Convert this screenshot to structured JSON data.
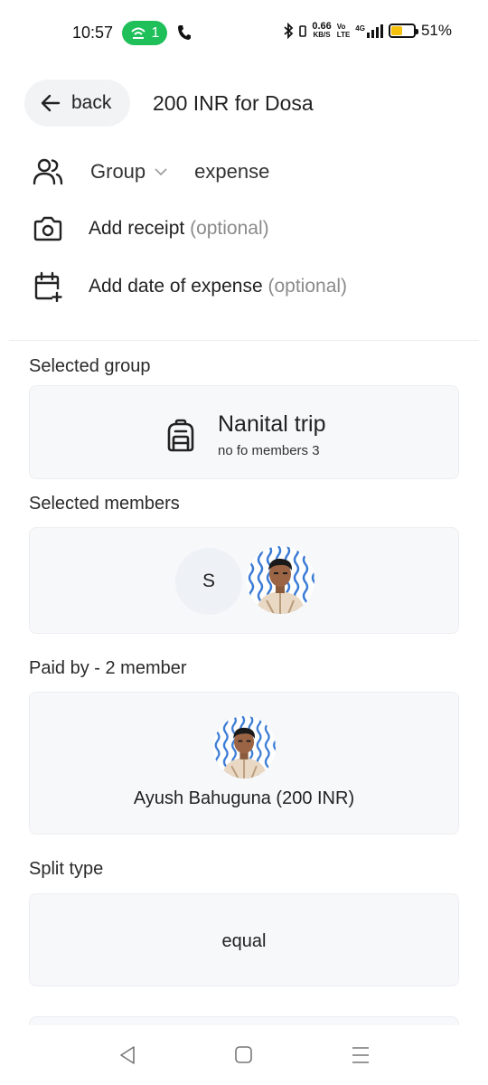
{
  "status_bar": {
    "time": "10:57",
    "hotspot_count": "1",
    "net_speed": "0.66",
    "net_unit": "KB/S",
    "volte_top": "Vo",
    "volte_bottom": "LTE",
    "network": "4G",
    "battery_pct": "51%",
    "battery_level": 0.51
  },
  "header": {
    "back_label": "back",
    "title": "200 INR for Dosa"
  },
  "options": {
    "group_label": "Group",
    "expense_label": "expense",
    "receipt_label": "Add receipt",
    "receipt_optional": "(optional)",
    "date_label": "Add date of expense",
    "date_optional": "(optional)"
  },
  "selected_group": {
    "section_label": "Selected group",
    "name": "Nanital trip",
    "members_text": "no fo members 3",
    "icon": "backpack-icon"
  },
  "selected_members": {
    "section_label": "Selected members",
    "initial": "S"
  },
  "paid_by": {
    "section_label": "Paid by - 2 member",
    "payer": "Ayush Bahuguna (200 INR)"
  },
  "split": {
    "section_label": "Split type",
    "value": "equal"
  },
  "colors": {
    "hotspot_green": "#1fbf5a",
    "battery_yellow": "#f4c20d",
    "card_bg": "#f7f8fa",
    "avatar_pattern": "#3a7bd5"
  }
}
